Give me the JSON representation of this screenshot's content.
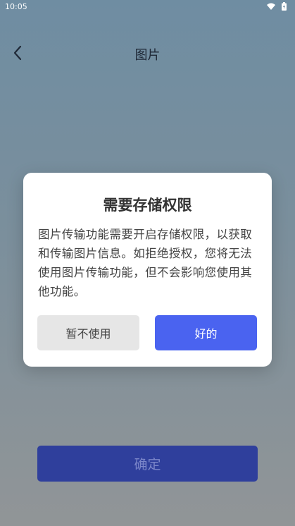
{
  "status_bar": {
    "time": "10:05",
    "icons": [
      "wifi-icon",
      "battery-icon"
    ]
  },
  "app_bar": {
    "back_icon": "chevron-left-icon",
    "title": "图片"
  },
  "confirm_button": {
    "label": "确定"
  },
  "dialog": {
    "title": "需要存储权限",
    "message": "图片传输功能需要开启存储权限，以获取和传输图片信息。如拒绝授权，您将无法使用图片传输功能，但不会影响您使用其他功能。",
    "cancel_label": "暂不使用",
    "ok_label": "好的"
  },
  "colors": {
    "primary": "#4a63f0",
    "confirm_bg": "#2f3f9c",
    "cancel_bg": "#e6e6e6"
  }
}
